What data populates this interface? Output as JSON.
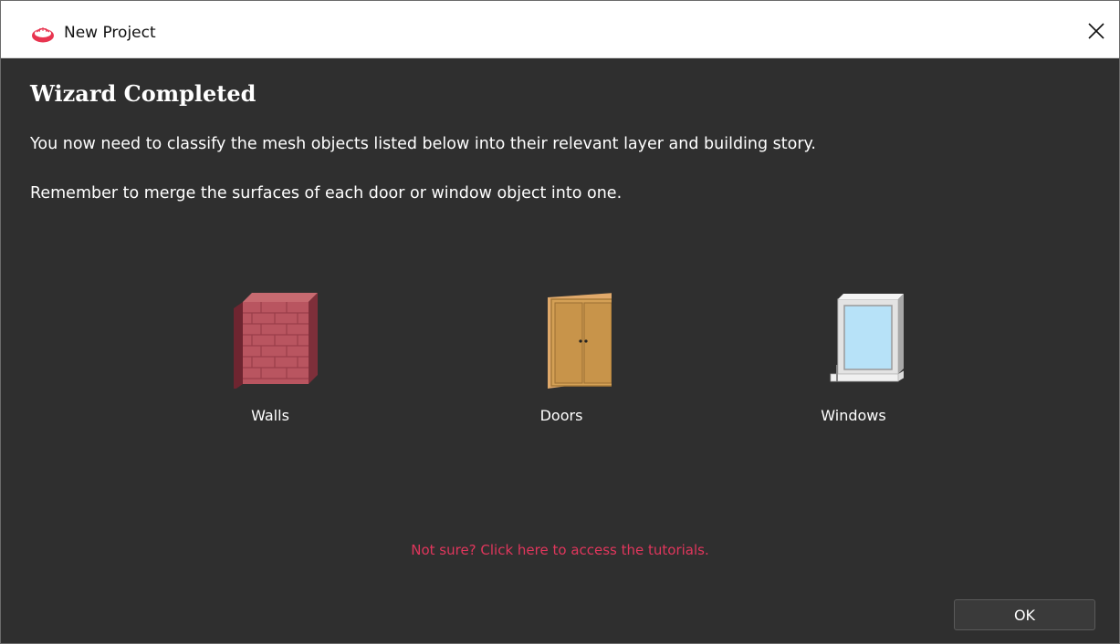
{
  "window": {
    "title": "New Project",
    "app_icon": "app-logo-icon",
    "close_icon": "close-icon"
  },
  "main": {
    "heading": "Wizard Completed",
    "paragraphs": [
      "You now need to classify the mesh objects listed below into their relevant layer and building story.",
      "Remember to merge the surfaces of each door or window object into one."
    ],
    "categories": [
      {
        "label": "Walls",
        "icon": "brick-wall-icon"
      },
      {
        "label": "Doors",
        "icon": "double-door-icon"
      },
      {
        "label": "Windows",
        "icon": "window-icon"
      }
    ],
    "tutorial_link": "Not sure? Click here to access the tutorials."
  },
  "footer": {
    "ok_label": "OK"
  },
  "colors": {
    "background": "#2f2f2f",
    "titlebar": "#ffffff",
    "link": "#e0365c",
    "text": "#ffffff"
  }
}
